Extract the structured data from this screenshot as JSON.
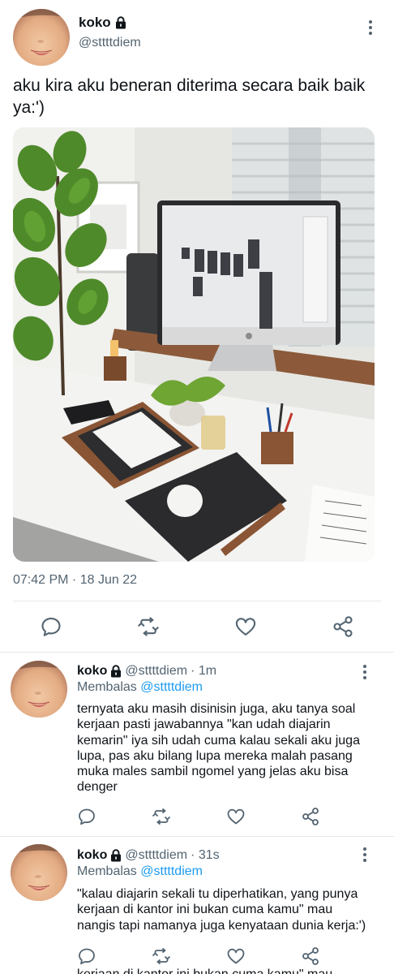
{
  "main_tweet": {
    "display_name": "koko",
    "handle": "@sttttdiem",
    "text": "aku kira aku beneran diterima secara baik baik ya:')",
    "timestamp": "07:42 PM · 18 Jun 22",
    "icons": [
      "lock-icon",
      "more-icon",
      "reply-icon",
      "retweet-icon",
      "like-icon",
      "share-icon"
    ]
  },
  "replies": [
    {
      "display_name": "koko",
      "handle": "@sttttdiem",
      "time": "· 1m",
      "replying_prefix": "Membalas",
      "replying_to": "@sttttdiem",
      "text": "ternyata aku masih disinisin juga, aku tanya soal kerjaan pasti jawabannya \"kan udah diajarin kemarin\" iya sih udah cuma kalau sekali aku juga lupa, pas aku bilang lupa mereka malah pasang muka males sambil ngomel yang jelas aku bisa denger"
    },
    {
      "display_name": "koko",
      "handle": "@sttttdiem",
      "time": "· 31s",
      "replying_prefix": "Membalas",
      "replying_to": "@sttttdiem",
      "text": "\"kalau diajarin sekali tu diperhatikan, yang punya kerjaan di kantor ini bukan cuma kamu\" mau nangis tapi namanya juga kenyataan dunia kerja:')"
    }
  ],
  "cut_off_text": "kerjaan di kantor ini bukan cuma kamu\" mau",
  "colors": {
    "text": "#0f1419",
    "secondary": "#536471",
    "link": "#1d9bf0",
    "divider": "#e4e8eb"
  }
}
